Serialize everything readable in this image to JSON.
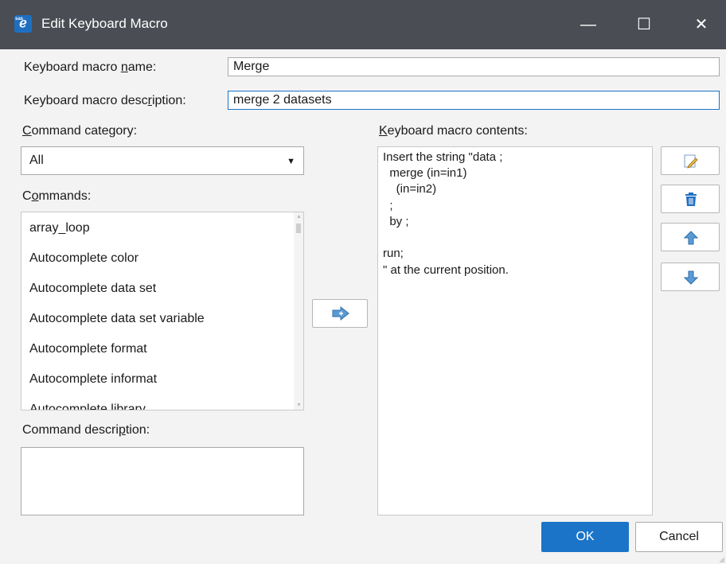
{
  "window": {
    "title": "Edit Keyboard Macro",
    "minimize": "—",
    "maximize": "☐",
    "close": "✕"
  },
  "form": {
    "name_label_pre": "Keyboard macro ",
    "name_label_key": "n",
    "name_label_post": "ame:",
    "name_value": "Merge",
    "desc_label_pre": "Keyboard macro desc",
    "desc_label_key": "r",
    "desc_label_post": "iption:",
    "desc_value": "merge 2 datasets"
  },
  "category": {
    "label_key": "C",
    "label_post": "ommand category:",
    "selected": "All"
  },
  "commands": {
    "label_pre": "C",
    "label_key": "o",
    "label_post": "mmands:",
    "items": [
      "array_loop",
      "Autocomplete color",
      "Autocomplete data set",
      "Autocomplete data set variable",
      "Autocomplete format",
      "Autocomplete informat",
      "Autocomplete library"
    ]
  },
  "command_description": {
    "label_pre": "Command descri",
    "label_key": "p",
    "label_post": "tion:"
  },
  "contents": {
    "label_key": "K",
    "label_post": "eyboard macro contents:",
    "lines": [
      "Insert the string \"data ;",
      "  merge (in=in1)",
      "    (in=in2)",
      "  ;",
      "  by ;",
      "",
      "run;",
      "\" at the current position."
    ]
  },
  "buttons": {
    "ok": "OK",
    "cancel": "Cancel"
  },
  "colors": {
    "accent": "#1b74c8",
    "titlebar": "#4a4d53"
  }
}
